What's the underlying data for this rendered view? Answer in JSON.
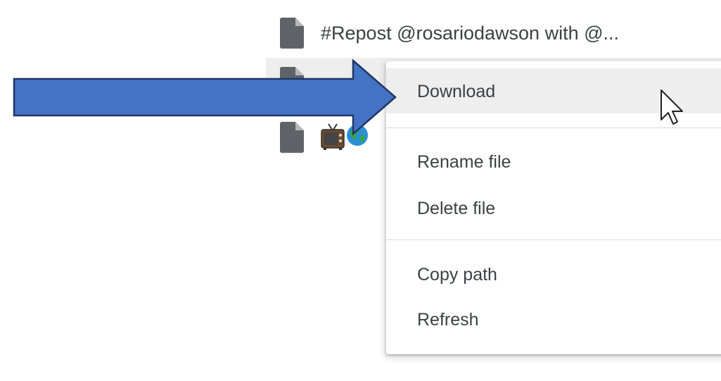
{
  "file_list": {
    "items": [
      {
        "name": "#Repost @rosariodawson with @...",
        "icon": "file-icon"
      },
      {
        "name": "",
        "icon": "file-icon"
      },
      {
        "name": "",
        "icon": "file-icon",
        "emoji": [
          "tv-emoji",
          "globe-emoji"
        ]
      }
    ]
  },
  "context_menu": {
    "items": [
      {
        "label": "Download",
        "hovered": true
      },
      {
        "label": "Rename file"
      },
      {
        "label": "Delete file"
      },
      {
        "label": "Copy path"
      },
      {
        "label": "Refresh"
      }
    ]
  },
  "annotation": {
    "arrow_color": "#4472c4",
    "arrow_outline": "#1f3864"
  },
  "colors": {
    "hover_background": "#eeeeee",
    "text": "#3c4043",
    "icon": "#5f6368"
  }
}
